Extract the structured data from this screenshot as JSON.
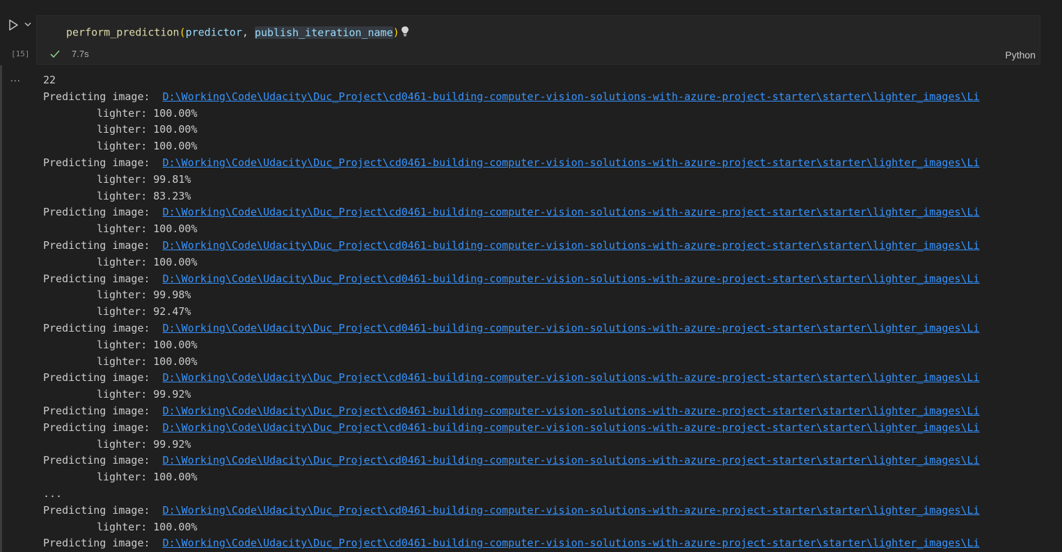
{
  "cell": {
    "run_label": "Run cell",
    "execution_count": "[15]",
    "code": {
      "function": "perform_prediction",
      "open_paren": "(",
      "arg1": "predictor",
      "comma": ", ",
      "arg2": "publish_iteration_name",
      "close_paren": ")"
    },
    "duration": "7.7s",
    "language": "Python"
  },
  "output": {
    "more_label": "...",
    "count_line": "22",
    "prefix": "Predicting image:  ",
    "path": "D:\\Working\\Code\\Udacity\\Duc_Project\\cd0461-building-computer-vision-solutions-with-azure-project-starter\\starter\\lighter_images\\Li",
    "ellipsis": "...",
    "blocks": [
      {
        "tags": [
          "lighter: 100.00%",
          "lighter: 100.00%",
          "lighter: 100.00%"
        ]
      },
      {
        "tags": [
          "lighter: 99.81%",
          "lighter: 83.23%"
        ]
      },
      {
        "tags": [
          "lighter: 100.00%"
        ]
      },
      {
        "tags": [
          "lighter: 100.00%"
        ]
      },
      {
        "tags": [
          "lighter: 99.98%",
          "lighter: 92.47%"
        ]
      },
      {
        "tags": [
          "lighter: 100.00%",
          "lighter: 100.00%"
        ]
      },
      {
        "tags": [
          "lighter: 99.92%"
        ]
      },
      {
        "tags": []
      },
      {
        "tags": [
          "lighter: 99.92%"
        ]
      },
      {
        "tags": [
          "lighter: 100.00%"
        ]
      }
    ],
    "tail_blocks": [
      {
        "tags": [
          "lighter: 100.00%"
        ]
      },
      {
        "tags": []
      }
    ]
  },
  "colors": {
    "background": "#1f1f1f",
    "editor_background": "#252526",
    "link": "#3794ff",
    "function": "#dcdcaa",
    "variable": "#9cdcfe",
    "bracket": "#ffd700",
    "success": "#89d185"
  },
  "icons": {
    "run": "play-icon",
    "run_menu": "chevron-down-icon",
    "hint": "lightbulb-icon",
    "status": "check-icon",
    "output_actions": "more-icon"
  }
}
